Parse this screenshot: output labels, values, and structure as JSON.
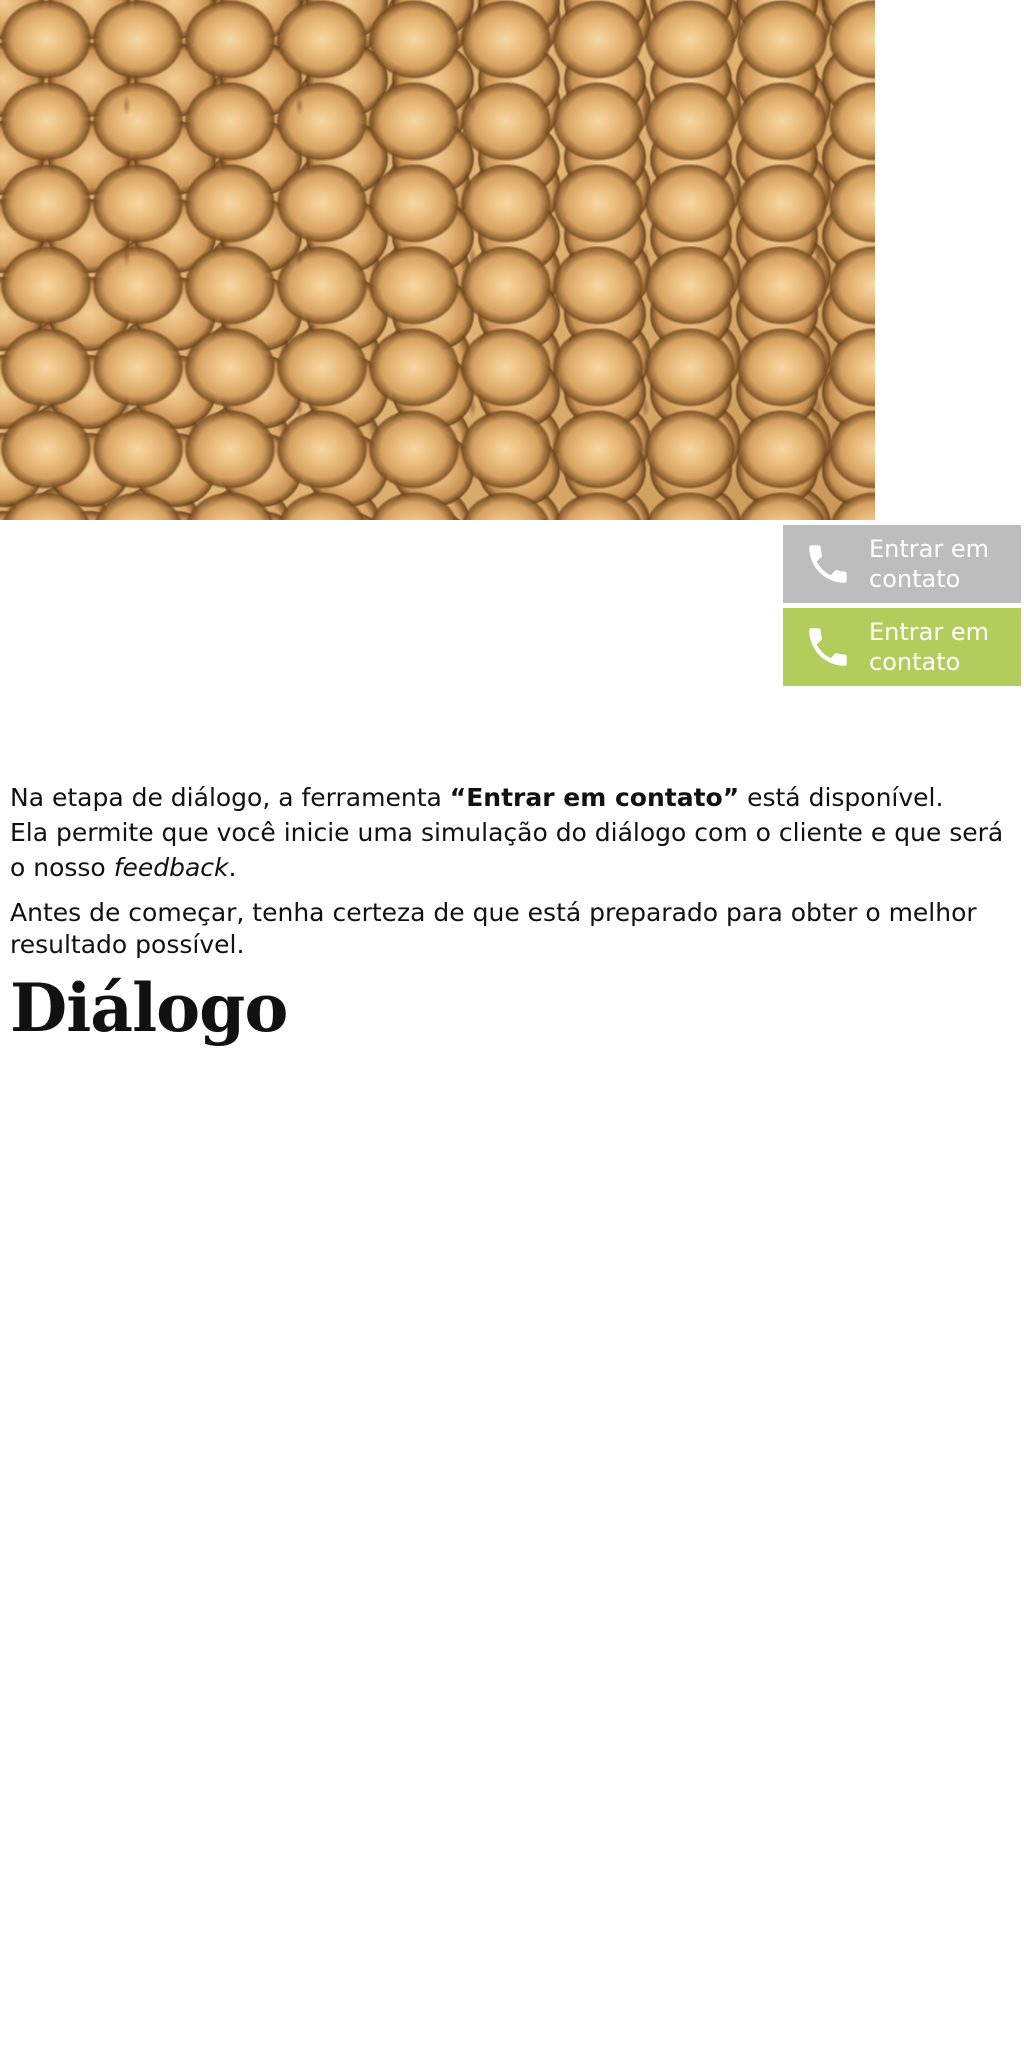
{
  "hero": {
    "image": "soybeans-photo"
  },
  "contact_buttons": [
    {
      "label": "Entrar em contato",
      "icon": "phone-icon",
      "background": "#bdbdbd"
    },
    {
      "label": "Entrar em contato",
      "icon": "phone-icon",
      "background": "#b3cd5c"
    }
  ],
  "intro": {
    "p1_before": "Na etapa de diálogo, a ferramenta ",
    "p1_bold": "“Entrar em contato”",
    "p1_after": " está disponível.",
    "p2_before": "Ela permite que você inicie uma simulação do diálogo com o cliente e que será o nosso ",
    "p2_italic": "feedback",
    "p2_after": ".",
    "p3": "Antes de começar, tenha certeza de que está preparado para obter o melhor resultado possível."
  },
  "heading": "Diálogo",
  "colors": {
    "text": "#111111",
    "button_grey": "#bdbdbd",
    "button_green": "#b3cd5c",
    "button_text": "#ffffff"
  }
}
